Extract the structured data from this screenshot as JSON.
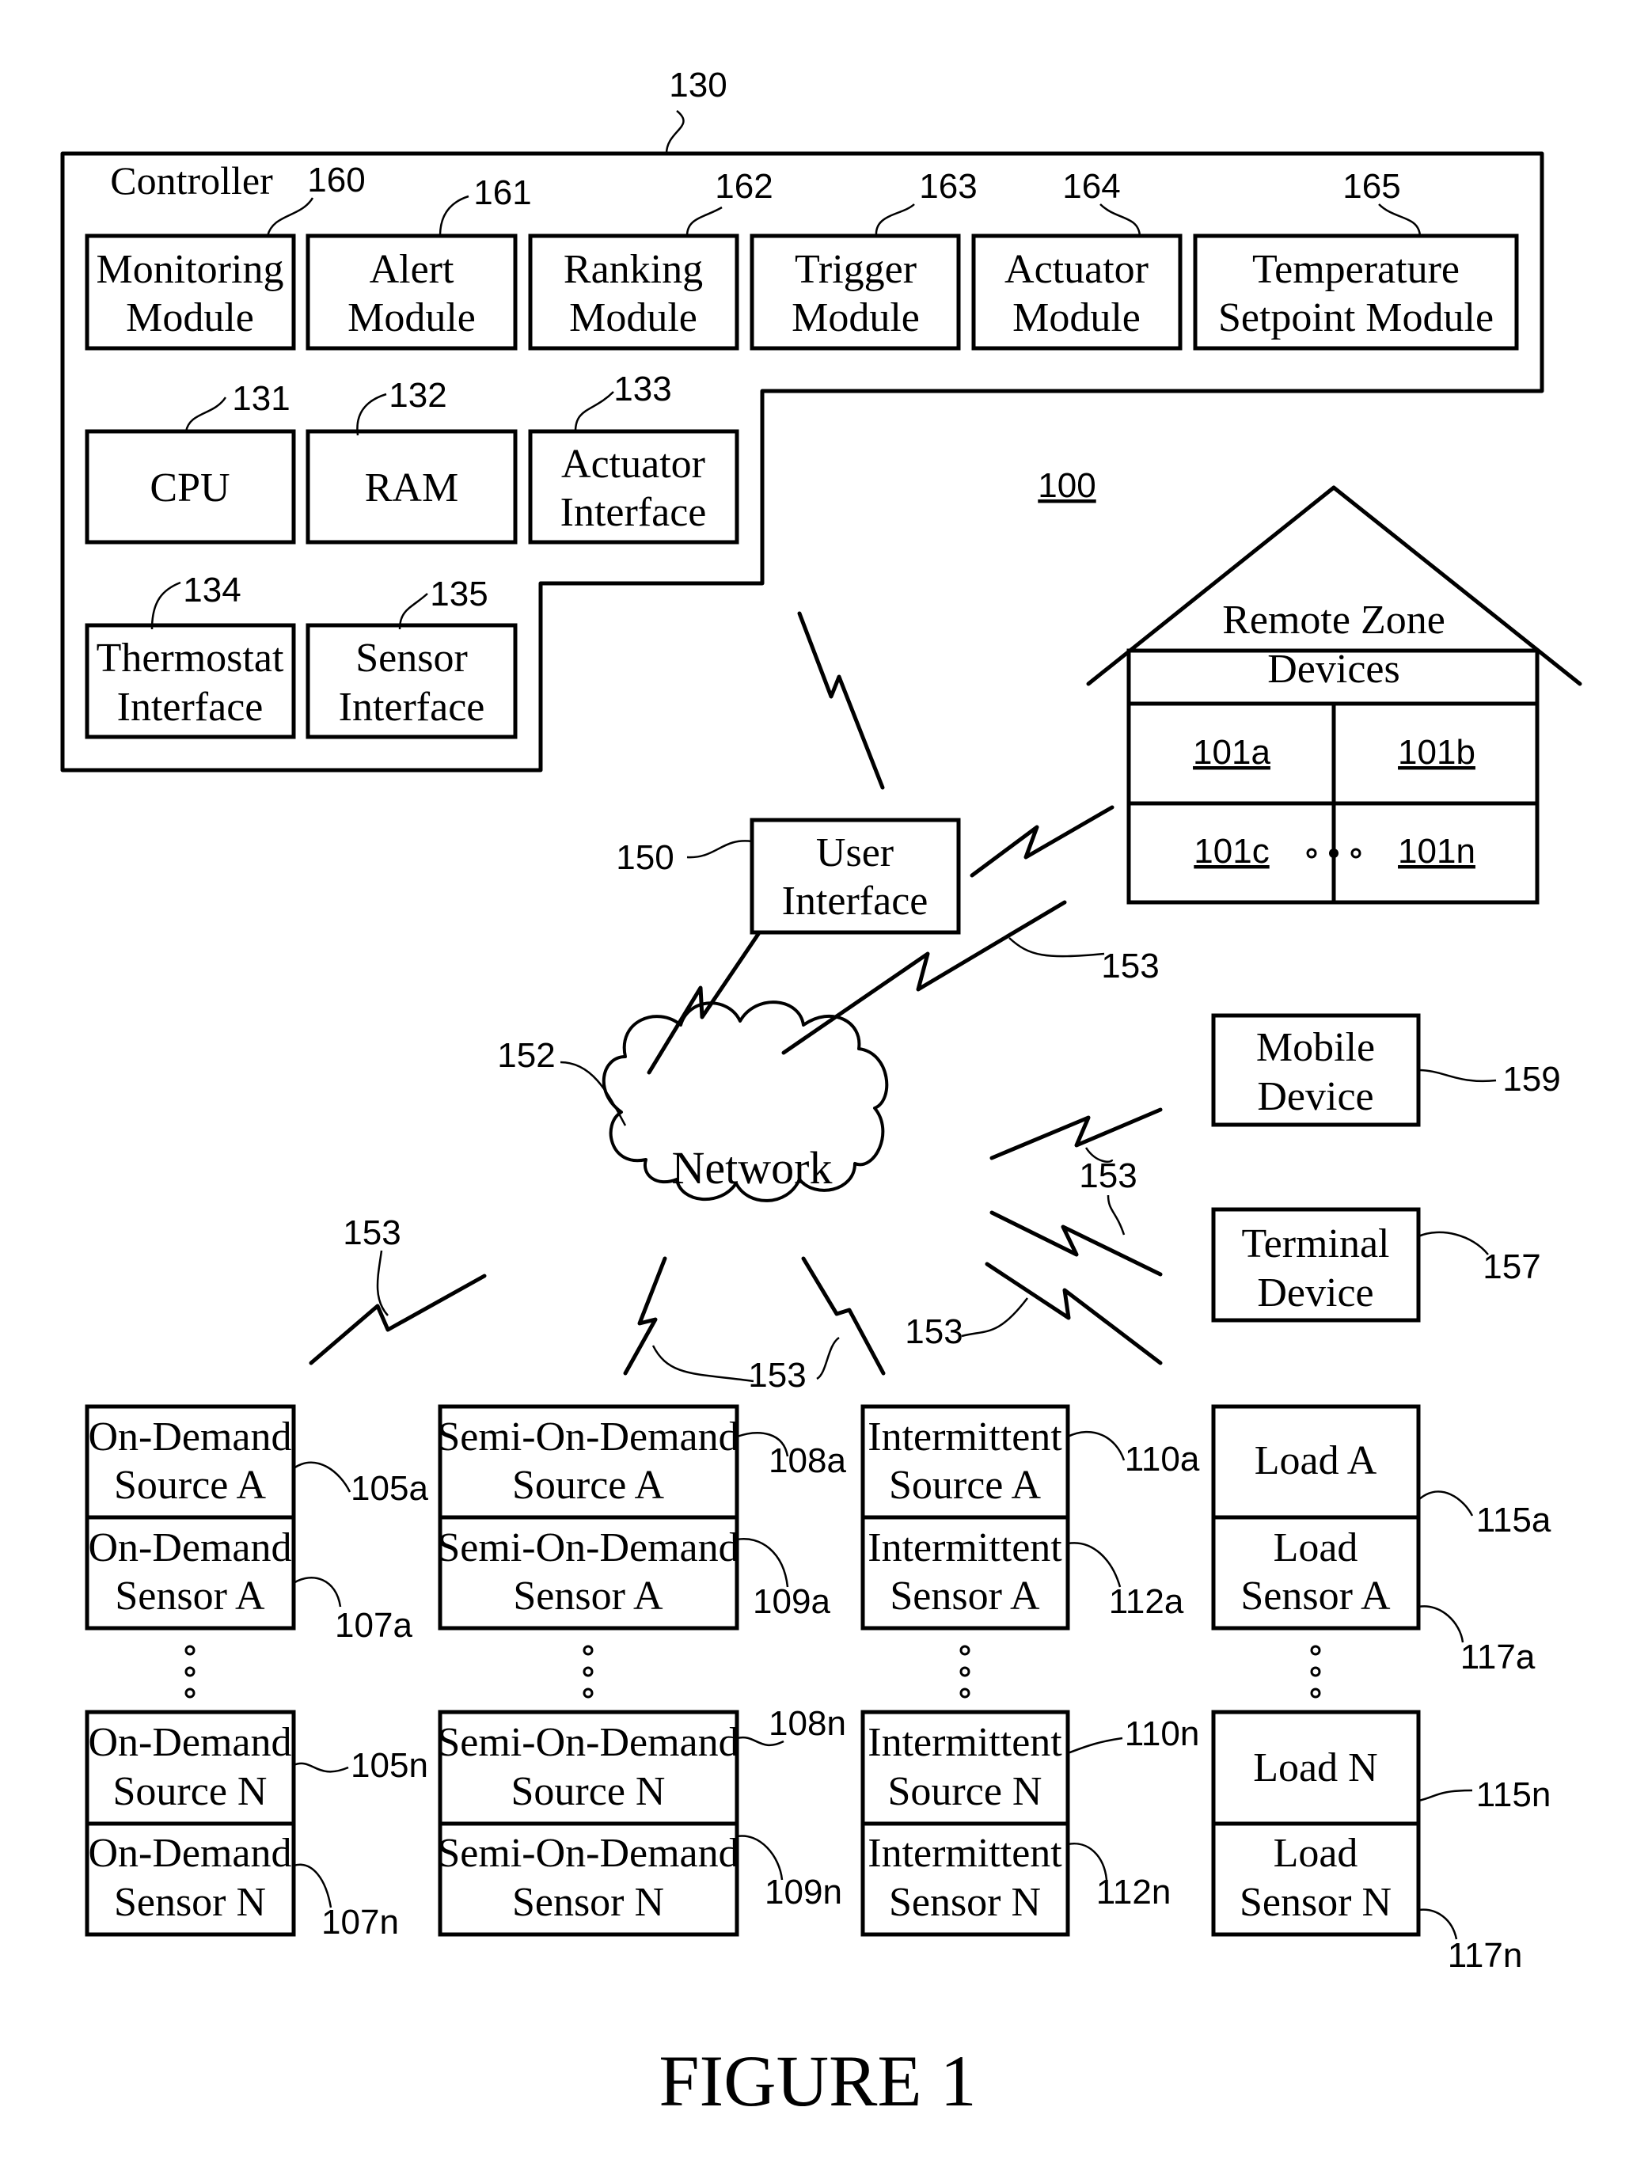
{
  "figure_title": "FIGURE 1",
  "system_ref": "100",
  "controller": {
    "label": "Controller",
    "ref": "130",
    "modules": [
      {
        "line1": "Monitoring",
        "line2": "Module",
        "ref": "160"
      },
      {
        "line1": "Alert",
        "line2": "Module",
        "ref": "161"
      },
      {
        "line1": "Ranking",
        "line2": "Module",
        "ref": "162"
      },
      {
        "line1": "Trigger",
        "line2": "Module",
        "ref": "163"
      },
      {
        "line1": "Actuator",
        "line2": "Module",
        "ref": "164"
      },
      {
        "line1": "Temperature",
        "line2": "Setpoint Module",
        "ref": "165"
      }
    ],
    "components": [
      {
        "line1": "CPU",
        "line2": "",
        "ref": "131"
      },
      {
        "line1": "RAM",
        "line2": "",
        "ref": "132"
      },
      {
        "line1": "Actuator",
        "line2": "Interface",
        "ref": "133"
      },
      {
        "line1": "Thermostat",
        "line2": "Interface",
        "ref": "134"
      },
      {
        "line1": "Sensor",
        "line2": "Interface",
        "ref": "135"
      }
    ]
  },
  "remote_zone": {
    "line1": "Remote Zone",
    "line2": "Devices",
    "zones": [
      "101a",
      "101b",
      "101c",
      "101n"
    ]
  },
  "user_interface": {
    "line1": "User",
    "line2": "Interface",
    "ref": "150"
  },
  "network": {
    "label": "Network",
    "ref": "152"
  },
  "wireless_ref": "153",
  "mobile_device": {
    "line1": "Mobile",
    "line2": "Device",
    "ref": "159"
  },
  "terminal_device": {
    "line1": "Terminal",
    "line2": "Device",
    "ref": "157"
  },
  "columns": [
    {
      "top_a": {
        "line1": "On-Demand",
        "line2": "Source A",
        "ref": "105a"
      },
      "bot_a": {
        "line1": "On-Demand",
        "line2": "Sensor A",
        "ref": "107a"
      },
      "top_n": {
        "line1": "On-Demand",
        "line2": "Source N",
        "ref": "105n"
      },
      "bot_n": {
        "line1": "On-Demand",
        "line2": "Sensor N",
        "ref": "107n"
      }
    },
    {
      "top_a": {
        "line1": "Semi-On-Demand",
        "line2": "Source A",
        "ref": "108a"
      },
      "bot_a": {
        "line1": "Semi-On-Demand",
        "line2": "Sensor A",
        "ref": "109a"
      },
      "top_n": {
        "line1": "Semi-On-Demand",
        "line2": "Source N",
        "ref": "108n"
      },
      "bot_n": {
        "line1": "Semi-On-Demand",
        "line2": "Sensor N",
        "ref": "109n"
      }
    },
    {
      "top_a": {
        "line1": "Intermittent",
        "line2": "Source A",
        "ref": "110a"
      },
      "bot_a": {
        "line1": "Intermittent",
        "line2": "Sensor A",
        "ref": "112a"
      },
      "top_n": {
        "line1": "Intermittent",
        "line2": "Source N",
        "ref": "110n"
      },
      "bot_n": {
        "line1": "Intermittent",
        "line2": "Sensor N",
        "ref": "112n"
      }
    },
    {
      "top_a": {
        "line1": "Load A",
        "line2": "",
        "ref": "115a"
      },
      "bot_a": {
        "line1": "Load",
        "line2": "Sensor A",
        "ref": "117a"
      },
      "top_n": {
        "line1": "Load N",
        "line2": "",
        "ref": "115n"
      },
      "bot_n": {
        "line1": "Load",
        "line2": "Sensor N",
        "ref": "117n"
      }
    }
  ]
}
